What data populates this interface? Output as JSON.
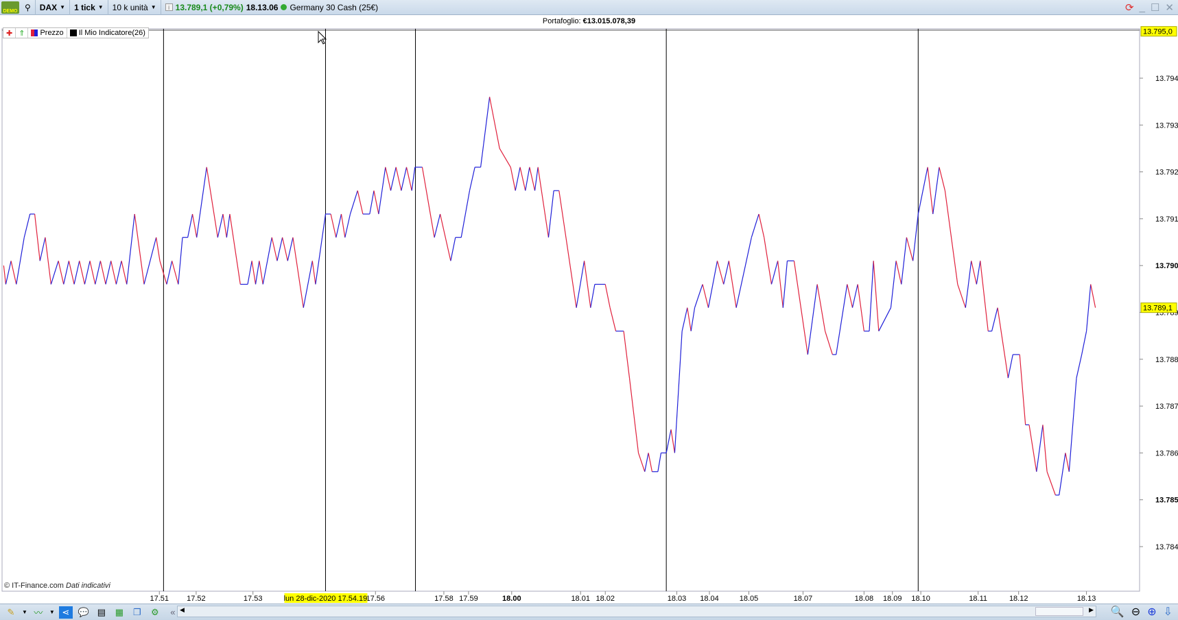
{
  "topbar": {
    "demo_badge": "DEMO",
    "instrument": "DAX",
    "interval": "1 tick",
    "units": "10 k unità",
    "price_change": "13.789,1 (+0,79%)",
    "time": "18.13.06",
    "instrument_name": "Germany 30 Cash (25€)"
  },
  "portfolio": {
    "label": "Portafoglio:",
    "value": "€13.015.078,39"
  },
  "legend": {
    "items": [
      {
        "label": "Prezzo"
      },
      {
        "label": "Il Mio Indicatore(26)"
      }
    ]
  },
  "footer": {
    "copyright": "© IT-Finance.com",
    "note": "Dati indicativi"
  },
  "colors": {
    "up": "#1f1fd8",
    "down": "#e0203c",
    "badge": "#ffff00",
    "accent": "#1e7be0"
  },
  "icons": [
    "demo-icon",
    "connection-icon",
    "info-icon",
    "refresh-icon",
    "minimize-icon",
    "maximize-icon",
    "close-icon",
    "drawing-tools-icon",
    "indicators-icon",
    "share-icon",
    "chat-icon",
    "list-icon",
    "orderbook-icon",
    "windows-icon",
    "settings-icon",
    "zoom-fit-icon",
    "zoom-out-icon",
    "zoom-in-icon",
    "download-icon"
  ],
  "chart_data": {
    "type": "line",
    "xlim": [
      0,
      216.7
    ],
    "ylim": [
      13783.4,
      13795.4
    ],
    "y_ticks": [
      {
        "value": 13794,
        "label": "13.794"
      },
      {
        "value": 13793,
        "label": "13.793"
      },
      {
        "value": 13792,
        "label": "13.792"
      },
      {
        "value": 13791,
        "label": "13.791"
      },
      {
        "value": 13790,
        "label": "13.790",
        "bold": true
      },
      {
        "value": 13789,
        "label": "13.789"
      },
      {
        "value": 13788,
        "label": "13.788"
      },
      {
        "value": 13787,
        "label": "13.787"
      },
      {
        "value": 13786,
        "label": "13.786"
      },
      {
        "value": 13785,
        "label": "13.785",
        "bold": true
      },
      {
        "value": 13784,
        "label": "13.784"
      }
    ],
    "price_badges": [
      {
        "value": 13795.0,
        "label": "13.795,0"
      },
      {
        "value": 13789.1,
        "label": "13.789,1"
      }
    ],
    "x_ticks": [
      {
        "tick": 30.3,
        "label": "17.51"
      },
      {
        "tick": 37.3,
        "label": "17.52"
      },
      {
        "tick": 48.1,
        "label": "17.53"
      },
      {
        "tick": 71.4,
        "label": "17.56"
      },
      {
        "tick": 84.4,
        "label": "17.58"
      },
      {
        "tick": 89.1,
        "label": "17.59"
      },
      {
        "tick": 97.3,
        "label": "18.00",
        "bold": true
      },
      {
        "tick": 110.4,
        "label": "18.01"
      },
      {
        "tick": 115.1,
        "label": "18.02"
      },
      {
        "tick": 128.7,
        "label": "18.03"
      },
      {
        "tick": 134.9,
        "label": "18.04"
      },
      {
        "tick": 142.4,
        "label": "18.05"
      },
      {
        "tick": 152.7,
        "label": "18.07"
      },
      {
        "tick": 164.3,
        "label": "18.08"
      },
      {
        "tick": 169.7,
        "label": "18.09"
      },
      {
        "tick": 175.1,
        "label": "18.10"
      },
      {
        "tick": 186,
        "label": "18.11"
      },
      {
        "tick": 193.7,
        "label": "18.12"
      },
      {
        "tick": 206.6,
        "label": "18.13"
      }
    ],
    "crosshair": {
      "tick": 61.9,
      "label": "lun 28-dic-2020 17.54.19"
    },
    "separators": [
      31.1,
      61.9,
      79,
      126.7,
      174.6
    ],
    "points": [
      [
        0.7,
        13790.0
      ],
      [
        1.1,
        13789.6
      ],
      [
        2.1,
        13790.1
      ],
      [
        3.1,
        13789.6
      ],
      [
        4.6,
        13790.6
      ],
      [
        5.7,
        13791.1
      ],
      [
        6.6,
        13791.1
      ],
      [
        7.6,
        13790.1
      ],
      [
        8.6,
        13790.6
      ],
      [
        9.7,
        13789.6
      ],
      [
        11.1,
        13790.1
      ],
      [
        12.1,
        13789.6
      ],
      [
        13.1,
        13790.1
      ],
      [
        14.1,
        13789.6
      ],
      [
        15.1,
        13790.1
      ],
      [
        16.1,
        13789.6
      ],
      [
        17.1,
        13790.1
      ],
      [
        18.1,
        13789.6
      ],
      [
        19.1,
        13790.1
      ],
      [
        20.1,
        13789.6
      ],
      [
        21.1,
        13790.1
      ],
      [
        22.1,
        13789.6
      ],
      [
        23.1,
        13790.1
      ],
      [
        24.1,
        13789.6
      ],
      [
        25.6,
        13791.1
      ],
      [
        27.4,
        13789.6
      ],
      [
        29.7,
        13790.6
      ],
      [
        30.4,
        13790.1
      ],
      [
        31.7,
        13789.6
      ],
      [
        32.7,
        13790.1
      ],
      [
        33.9,
        13789.6
      ],
      [
        34.7,
        13790.6
      ],
      [
        35.7,
        13790.6
      ],
      [
        36.6,
        13791.1
      ],
      [
        37.4,
        13790.6
      ],
      [
        39.3,
        13792.1
      ],
      [
        41.4,
        13790.6
      ],
      [
        42.4,
        13791.1
      ],
      [
        43.1,
        13790.6
      ],
      [
        43.7,
        13791.1
      ],
      [
        45.7,
        13789.6
      ],
      [
        47.1,
        13789.6
      ],
      [
        47.9,
        13790.1
      ],
      [
        48.6,
        13789.6
      ],
      [
        49.3,
        13790.1
      ],
      [
        50,
        13789.6
      ],
      [
        51.7,
        13790.6
      ],
      [
        52.7,
        13790.1
      ],
      [
        53.7,
        13790.6
      ],
      [
        54.7,
        13790.1
      ],
      [
        55.7,
        13790.6
      ],
      [
        57.7,
        13789.1
      ],
      [
        59.4,
        13790.1
      ],
      [
        60,
        13789.6
      ],
      [
        61.9,
        13791.1
      ],
      [
        62.9,
        13791.1
      ],
      [
        63.9,
        13790.6
      ],
      [
        64.9,
        13791.1
      ],
      [
        65.6,
        13790.6
      ],
      [
        66.6,
        13791.1
      ],
      [
        68,
        13791.6
      ],
      [
        69,
        13791.1
      ],
      [
        70.3,
        13791.1
      ],
      [
        71.1,
        13791.6
      ],
      [
        72,
        13791.1
      ],
      [
        73.3,
        13792.1
      ],
      [
        74.3,
        13791.6
      ],
      [
        75.3,
        13792.1
      ],
      [
        76.3,
        13791.6
      ],
      [
        77.3,
        13792.1
      ],
      [
        78.3,
        13791.6
      ],
      [
        78.9,
        13792.1
      ],
      [
        80.3,
        13792.1
      ],
      [
        82.6,
        13790.6
      ],
      [
        83.7,
        13791.1
      ],
      [
        85.7,
        13790.1
      ],
      [
        86.6,
        13790.6
      ],
      [
        87.7,
        13790.6
      ],
      [
        89.3,
        13791.6
      ],
      [
        90.3,
        13792.1
      ],
      [
        91.4,
        13792.1
      ],
      [
        93.1,
        13793.6
      ],
      [
        95,
        13792.5
      ],
      [
        97.1,
        13792.1
      ],
      [
        98,
        13791.6
      ],
      [
        98.9,
        13792.1
      ],
      [
        99.9,
        13791.6
      ],
      [
        100.7,
        13792.1
      ],
      [
        101.7,
        13791.6
      ],
      [
        102.3,
        13792.1
      ],
      [
        104.3,
        13790.6
      ],
      [
        105.3,
        13791.6
      ],
      [
        106.3,
        13791.6
      ],
      [
        109.6,
        13789.1
      ],
      [
        111.1,
        13790.1
      ],
      [
        112.3,
        13789.1
      ],
      [
        113.1,
        13789.6
      ],
      [
        115.1,
        13789.6
      ],
      [
        116,
        13789.1
      ],
      [
        117.1,
        13788.6
      ],
      [
        118.6,
        13788.6
      ],
      [
        119.7,
        13787.6
      ],
      [
        121.4,
        13786.0
      ],
      [
        122.6,
        13785.6
      ],
      [
        123.3,
        13786.0
      ],
      [
        124,
        13785.6
      ],
      [
        125.1,
        13785.6
      ],
      [
        125.7,
        13786.0
      ],
      [
        126.7,
        13786.0
      ],
      [
        127.6,
        13786.5
      ],
      [
        128.3,
        13786.0
      ],
      [
        129.7,
        13788.6
      ],
      [
        130.7,
        13789.1
      ],
      [
        131.4,
        13788.6
      ],
      [
        132.1,
        13789.1
      ],
      [
        133.6,
        13789.6
      ],
      [
        134.7,
        13789.1
      ],
      [
        136.4,
        13790.1
      ],
      [
        137.6,
        13789.6
      ],
      [
        138.6,
        13790.1
      ],
      [
        140,
        13789.1
      ],
      [
        142.9,
        13790.6
      ],
      [
        144.3,
        13791.1
      ],
      [
        145.3,
        13790.6
      ],
      [
        146.7,
        13789.6
      ],
      [
        147.9,
        13790.1
      ],
      [
        148.9,
        13789.1
      ],
      [
        149.7,
        13790.1
      ],
      [
        151,
        13790.1
      ],
      [
        153.6,
        13788.1
      ],
      [
        155.4,
        13789.6
      ],
      [
        156.9,
        13788.6
      ],
      [
        158.3,
        13788.1
      ],
      [
        159,
        13788.1
      ],
      [
        161.1,
        13789.6
      ],
      [
        162.1,
        13789.1
      ],
      [
        163.1,
        13789.6
      ],
      [
        164.3,
        13788.6
      ],
      [
        165.3,
        13788.6
      ],
      [
        166.1,
        13790.1
      ],
      [
        167.1,
        13788.6
      ],
      [
        169.4,
        13789.1
      ],
      [
        170.4,
        13790.1
      ],
      [
        171.4,
        13789.6
      ],
      [
        172.4,
        13790.6
      ],
      [
        173.6,
        13790.1
      ],
      [
        174.6,
        13791.1
      ],
      [
        176.4,
        13792.1
      ],
      [
        177.4,
        13791.1
      ],
      [
        178.6,
        13792.1
      ],
      [
        179.7,
        13791.6
      ],
      [
        182.1,
        13789.6
      ],
      [
        183.6,
        13789.1
      ],
      [
        184.7,
        13790.1
      ],
      [
        185.7,
        13789.6
      ],
      [
        186.4,
        13790.1
      ],
      [
        187.9,
        13788.6
      ],
      [
        188.6,
        13788.6
      ],
      [
        189.7,
        13789.1
      ],
      [
        191.7,
        13787.6
      ],
      [
        192.6,
        13788.1
      ],
      [
        193.9,
        13788.1
      ],
      [
        195,
        13786.6
      ],
      [
        195.7,
        13786.6
      ],
      [
        197.1,
        13785.6
      ],
      [
        198.3,
        13786.6
      ],
      [
        199.1,
        13785.6
      ],
      [
        200.7,
        13785.1
      ],
      [
        201.4,
        13785.1
      ],
      [
        202.6,
        13786.0
      ],
      [
        203.3,
        13785.6
      ],
      [
        204.7,
        13787.6
      ],
      [
        205.7,
        13788.1
      ],
      [
        206.6,
        13788.6
      ],
      [
        207.4,
        13789.6
      ],
      [
        208.3,
        13789.1
      ]
    ]
  }
}
